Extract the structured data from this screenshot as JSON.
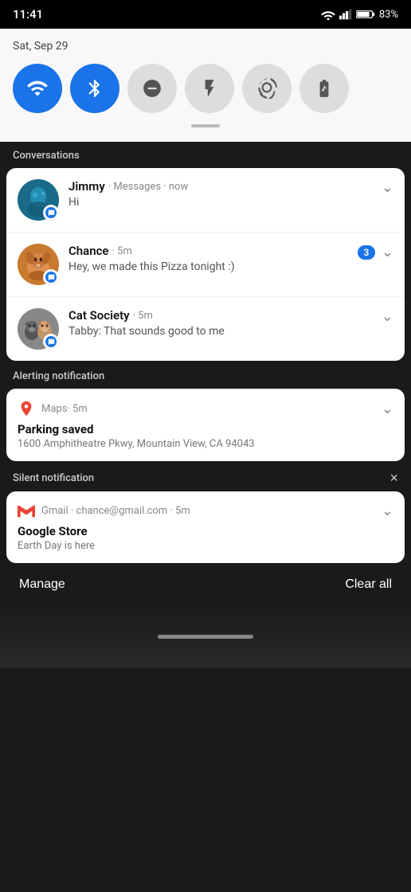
{
  "status_bar": {
    "time": "11:41",
    "battery": "83%"
  },
  "quick_settings": {
    "date": "Sat, Sep 29",
    "tiles": [
      {
        "id": "wifi",
        "label": "WiFi",
        "active": true,
        "icon": "📶"
      },
      {
        "id": "bluetooth",
        "label": "Bluetooth",
        "active": true,
        "icon": "⬤"
      },
      {
        "id": "dnd",
        "label": "Do Not Disturb",
        "active": false,
        "icon": "⊖"
      },
      {
        "id": "flashlight",
        "label": "Flashlight",
        "active": false,
        "icon": "🔦"
      },
      {
        "id": "autorotate",
        "label": "Auto Rotate",
        "active": false,
        "icon": "↻"
      },
      {
        "id": "battery",
        "label": "Battery Saver",
        "active": false,
        "icon": "🔋"
      }
    ]
  },
  "conversations": {
    "section_label": "Conversations",
    "items": [
      {
        "name": "Jimmy",
        "meta": "· Messages · now",
        "message": "Hi",
        "badge": null,
        "avatar_type": "jimmy"
      },
      {
        "name": "Chance",
        "meta": "· 5m",
        "message": "Hey, we made this Pizza tonight :)",
        "badge": "3",
        "avatar_type": "chance"
      },
      {
        "name": "Cat Society",
        "meta": "· 5m",
        "message": "Tabby: That sounds good to me",
        "badge": null,
        "avatar_type": "cat"
      }
    ]
  },
  "alerting_notification": {
    "section_label": "Alerting notification",
    "app": "Maps",
    "meta": "· 5m",
    "title": "Parking saved",
    "body": "1600 Amphitheatre Pkwy, Mountain View, CA 94043"
  },
  "silent_notification": {
    "section_label": "Silent notification",
    "close_label": "×",
    "app": "Gmail",
    "meta": "· chance@gmail.com · 5m",
    "title": "Google Store",
    "body": "Earth Day is here"
  },
  "bottom_bar": {
    "manage_label": "Manage",
    "clear_all_label": "Clear all"
  }
}
